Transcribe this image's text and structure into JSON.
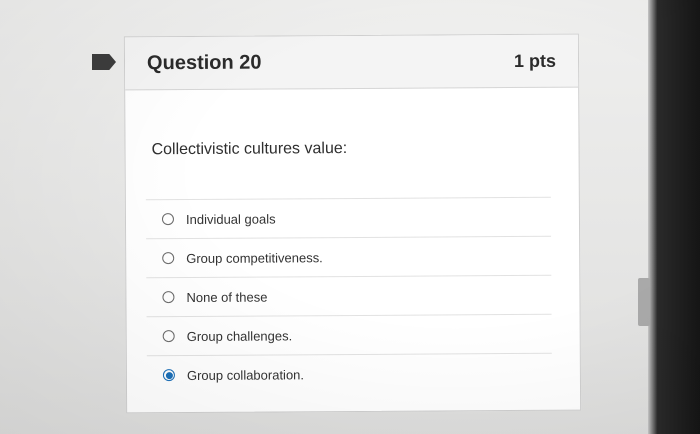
{
  "question": {
    "title": "Question 20",
    "points": "1 pts",
    "prompt": "Collectivistic cultures value:"
  },
  "answers": [
    {
      "label": "Individual goals",
      "selected": false
    },
    {
      "label": "Group competitiveness.",
      "selected": false
    },
    {
      "label": "None of these",
      "selected": false
    },
    {
      "label": "Group challenges.",
      "selected": false
    },
    {
      "label": "Group collaboration.",
      "selected": true
    }
  ],
  "colors": {
    "accent": "#1b6fb8",
    "flag": "#3c3c3c"
  },
  "icons": {
    "flag": "bookmark-flag-icon",
    "radio": "radio-icon"
  }
}
